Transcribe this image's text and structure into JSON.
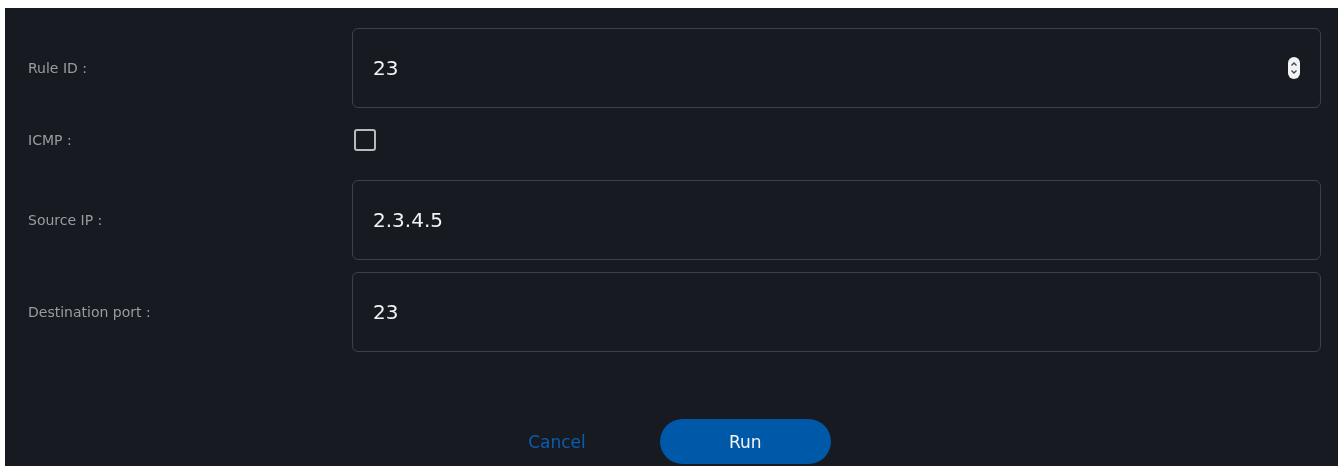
{
  "fields": [
    {
      "kind": "number",
      "label": "Rule ID :",
      "value": "23"
    },
    {
      "kind": "checkbox",
      "label": "ICMP :",
      "checked": false
    },
    {
      "kind": "text",
      "label": "Source IP :",
      "value": "2.3.4.5"
    },
    {
      "kind": "text",
      "label": "Destination port :",
      "value": "23"
    }
  ],
  "buttons": {
    "cancel": "Cancel",
    "run": "Run"
  }
}
